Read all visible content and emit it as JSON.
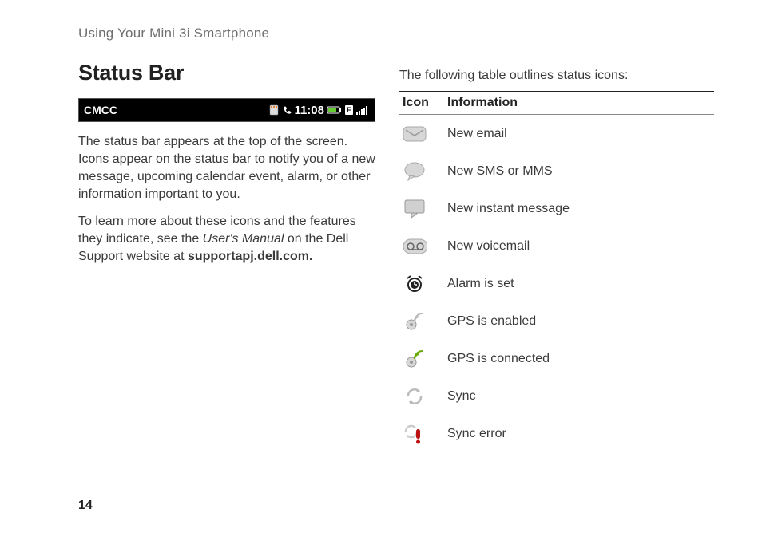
{
  "header": "Using Your Mini 3i Smartphone",
  "section_title": "Status Bar",
  "status_bar": {
    "carrier": "CMCC",
    "time": "11:08"
  },
  "para1": "The status bar appears at the top of the screen. Icons appear on the status bar to notify you of a new message, upcoming calendar event, alarm, or other information important to you.",
  "para2_a": "To learn more about these icons and the features they indicate, see the ",
  "para2_manual": "User's Manual",
  "para2_b": " on the Dell Support website at ",
  "para2_site": "supportapj.dell.com.",
  "right_intro": "The following table outlines status icons:",
  "table": {
    "icon_header": "Icon",
    "info_header": "Information",
    "rows": [
      {
        "label": "New email"
      },
      {
        "label": "New SMS or MMS"
      },
      {
        "label": "New instant message"
      },
      {
        "label": "New voicemail"
      },
      {
        "label": "Alarm is set"
      },
      {
        "label": "GPS is enabled"
      },
      {
        "label": "GPS is connected"
      },
      {
        "label": "Sync"
      },
      {
        "label": "Sync error"
      }
    ]
  },
  "page_number": "14"
}
